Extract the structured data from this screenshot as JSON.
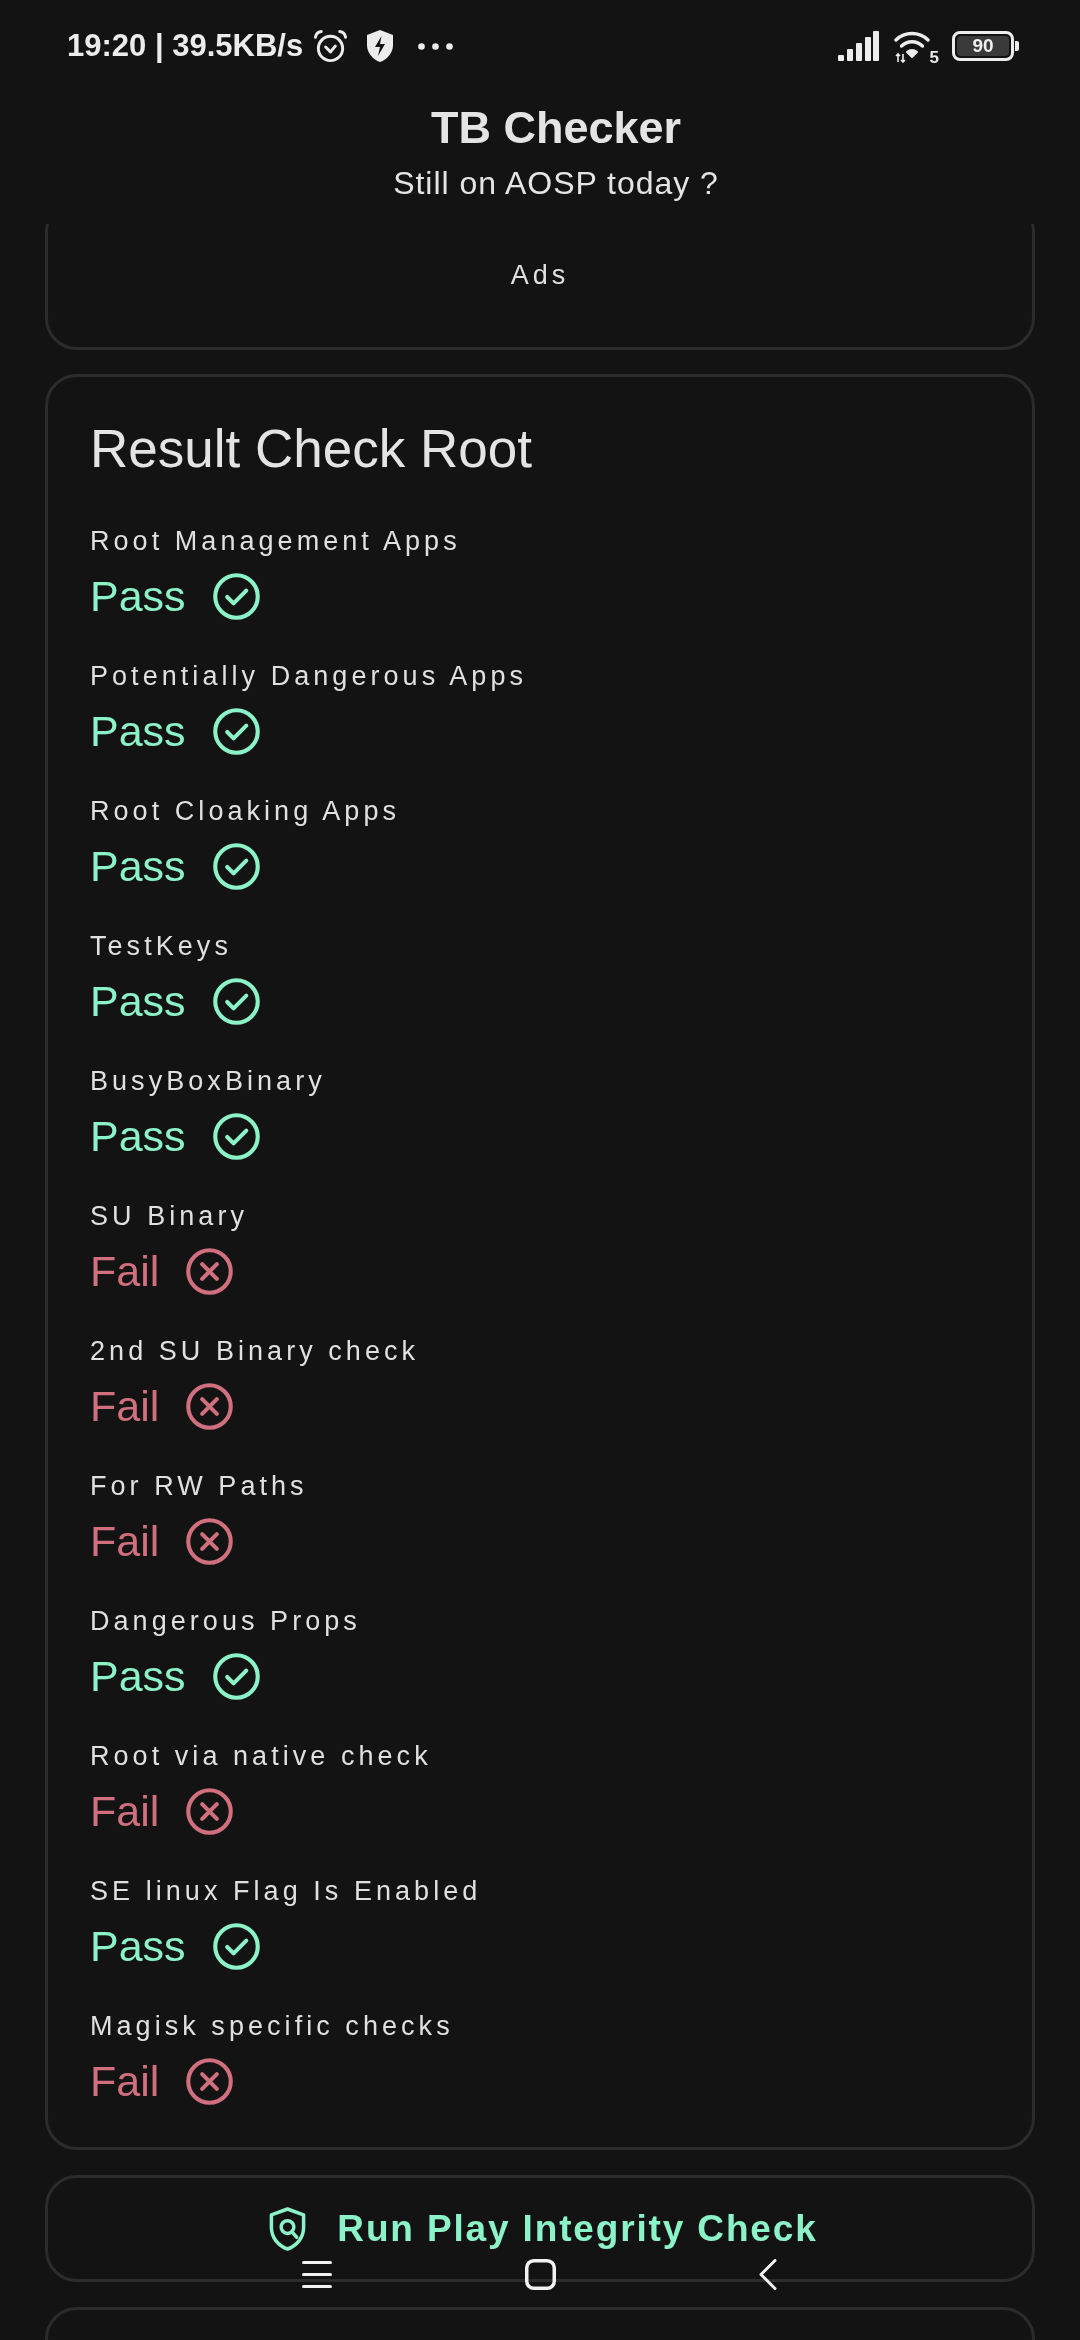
{
  "status_bar": {
    "time_speed": "19:20 | 39.5KB/s",
    "wifi_badge": "5",
    "battery": "90"
  },
  "header": {
    "title": "TB Checker",
    "subtitle": "Still on AOSP today ?"
  },
  "ad_card": {
    "label": "Ads"
  },
  "result_card": {
    "title": "Result Check Root",
    "checks": [
      {
        "name": "Root Management Apps",
        "result": "Pass",
        "passed": true
      },
      {
        "name": "Potentially Dangerous Apps",
        "result": "Pass",
        "passed": true
      },
      {
        "name": "Root Cloaking Apps",
        "result": "Pass",
        "passed": true
      },
      {
        "name": "TestKeys",
        "result": "Pass",
        "passed": true
      },
      {
        "name": "BusyBoxBinary",
        "result": "Pass",
        "passed": true
      },
      {
        "name": "SU Binary",
        "result": "Fail",
        "passed": false
      },
      {
        "name": "2nd SU Binary check",
        "result": "Fail",
        "passed": false
      },
      {
        "name": "For RW Paths",
        "result": "Fail",
        "passed": false
      },
      {
        "name": "Dangerous Props",
        "result": "Pass",
        "passed": true
      },
      {
        "name": "Root via native check",
        "result": "Fail",
        "passed": false
      },
      {
        "name": "SE linux Flag Is Enabled",
        "result": "Pass",
        "passed": true
      },
      {
        "name": "Magisk specific checks",
        "result": "Fail",
        "passed": false
      }
    ]
  },
  "integrity_button": {
    "label": "Run Play Integrity Check"
  }
}
